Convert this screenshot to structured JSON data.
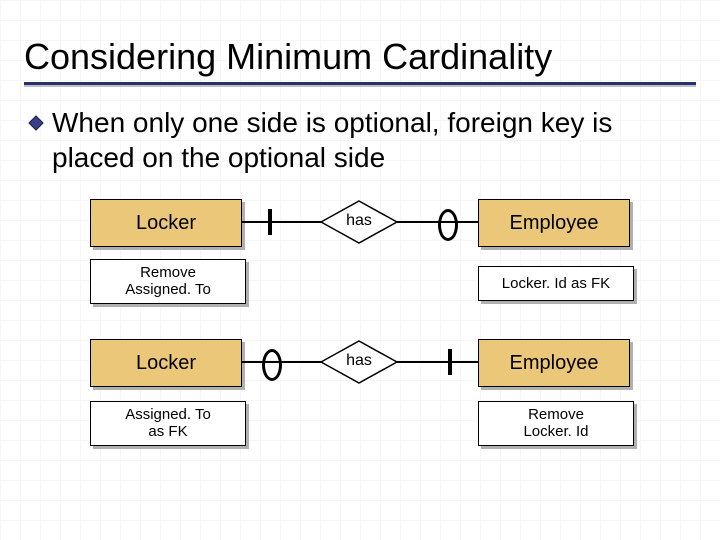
{
  "title": "Considering Minimum Cardinality",
  "bullet": "When only one side is optional, foreign key is placed on the optional side",
  "row1": {
    "left_entity": "Locker",
    "left_note_l1": "Remove",
    "left_note_l2": "Assigned. To",
    "relationship": "has",
    "left_cardinality": "mandatory-one",
    "right_cardinality": "optional-one",
    "right_entity": "Employee",
    "right_note": "Locker. Id as FK"
  },
  "row2": {
    "left_entity": "Locker",
    "left_note_l1": "Assigned. To",
    "left_note_l2": "as FK",
    "relationship": "has",
    "left_cardinality": "optional-one",
    "right_cardinality": "mandatory-one",
    "right_entity": "Employee",
    "right_note_l1": "Remove",
    "right_note_l2": "Locker. Id"
  }
}
